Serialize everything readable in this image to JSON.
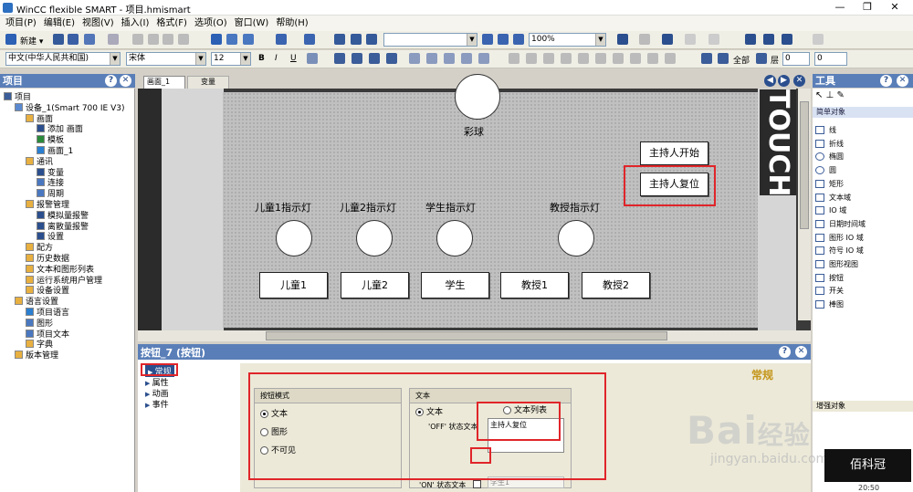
{
  "window": {
    "title": "WinCC flexible SMART - 项目.hmismart",
    "restore_glyph": "❐",
    "close_glyph": "✕"
  },
  "menu": [
    "项目(P)",
    "编辑(E)",
    "视图(V)",
    "插入(I)",
    "格式(F)",
    "选项(O)",
    "窗口(W)",
    "帮助(H)"
  ],
  "toolbar": {
    "new_label": "新建 ▾",
    "zoom": "100%",
    "language": "中文(中华人民共和国)",
    "font": "宋体",
    "font_size": "12",
    "all_label": "全部",
    "layer_label": "层",
    "layer1": "0",
    "layer2": "0"
  },
  "project_panel": {
    "title": "项目",
    "tree": [
      "项目",
      "设备_1(Smart 700 IE V3)",
      "画面",
      "添加 画面",
      "模板",
      "画面_1",
      "通讯",
      "变量",
      "连接",
      "周期",
      "报警管理",
      "模拟量报警",
      "离散量报警",
      "设置",
      "配方",
      "历史数据",
      "文本和图形列表",
      "运行系统用户管理",
      "设备设置",
      "语言设置",
      "项目语言",
      "图形",
      "项目文本",
      "字典",
      "版本管理"
    ]
  },
  "tabs": {
    "screen1": "画面_1",
    "vars": "变量"
  },
  "screen": {
    "ball_label": "彩球",
    "touch_text": "TOUCH",
    "host_start": "主持人开始",
    "host_reset": "主持人复位",
    "lamps": [
      "儿童1指示灯",
      "儿童2指示灯",
      "学生指示灯",
      "教授指示灯"
    ],
    "buttons": [
      "儿童1",
      "儿童2",
      "学生",
      "教授1",
      "教授2"
    ]
  },
  "tools_panel": {
    "title": "工具",
    "group": "简单对象",
    "items": [
      "线",
      "折线",
      "椭圆",
      "圆",
      "矩形",
      "文本域",
      "IO 域",
      "日期时间域",
      "图形 IO 域",
      "符号 IO 域",
      "图形视图",
      "按钮",
      "开关",
      "棒图"
    ],
    "enhanced": "增强对象"
  },
  "props": {
    "title": "按钮_7 (按钮)",
    "nav": [
      "常规",
      "属性",
      "动画",
      "事件"
    ],
    "header": "常规",
    "mode": {
      "title": "按钮模式",
      "options": [
        "文本",
        "图形",
        "不可见"
      ]
    },
    "text": {
      "title": "文本",
      "opt_text": "文本",
      "opt_list": "文本列表",
      "off_label": "'OFF' 状态文本",
      "off_value": "主持人复位",
      "on_label": "'ON' 状态文本",
      "on_value": "学生1"
    }
  },
  "watermark": {
    "brand": "Bai",
    "brand2": "经验",
    "url": "jingyan.baidu.com",
    "logo": "佰科冠",
    "time": "20:50"
  }
}
